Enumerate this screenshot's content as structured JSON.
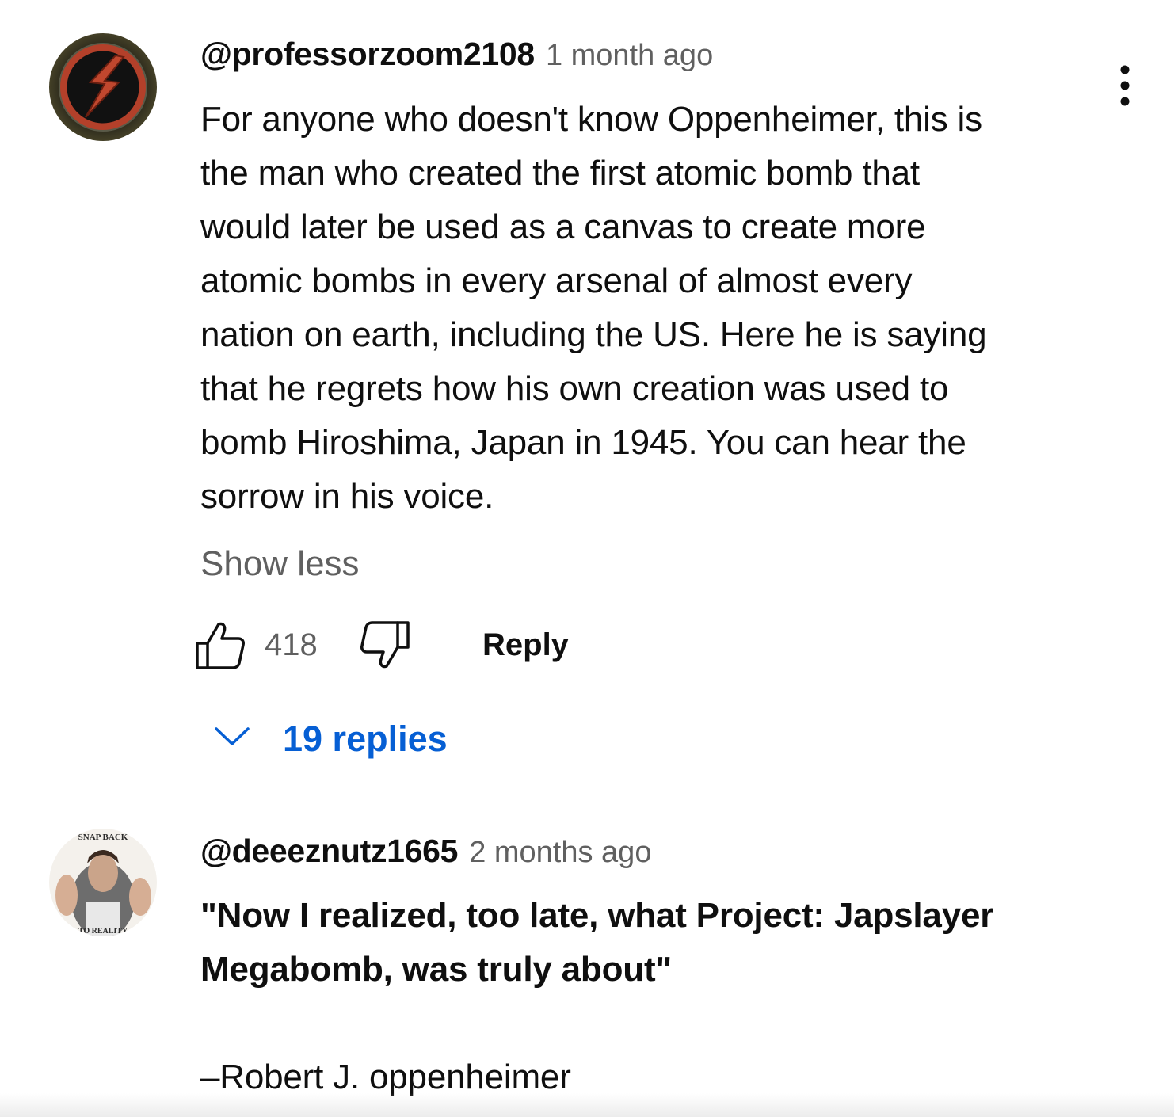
{
  "comments": [
    {
      "avatar_icon": "reverse-flash-emblem-icon",
      "handle": "@professorzoom2108",
      "time": "1 month ago",
      "text_lines": [
        "For anyone who doesn't know Oppenheimer, this is",
        "the man who created the first atomic bomb that",
        "would later be used as a canvas to create more",
        "atomic bombs in every arsenal of almost every",
        "nation on earth, including the US. Here he is saying",
        "that he regrets how his own creation was used to",
        "bomb Hiroshima, Japan in 1945. You can hear the",
        "sorrow in his voice."
      ],
      "show_less_label": "Show less",
      "like_count": "418",
      "reply_label": "Reply",
      "replies_label": "19 replies",
      "menu_icon": "more-vertical-icon"
    },
    {
      "avatar_icon": "snap-back-to-reality-avatar-icon",
      "avatar_text_top": "SNAP BACK",
      "avatar_text_bottom": "TO REALITY",
      "handle": "@deeeznutz1665",
      "time": "2 months ago",
      "text_lines": [
        "\"Now I realized, too late, what Project: Japslayer",
        "Megabomb, was truly about\""
      ],
      "signature": "–Robert J. oppenheimer"
    }
  ],
  "colors": {
    "link_blue": "#065fd4",
    "secondary_text": "#606060",
    "primary_text": "#0f0f0f"
  }
}
